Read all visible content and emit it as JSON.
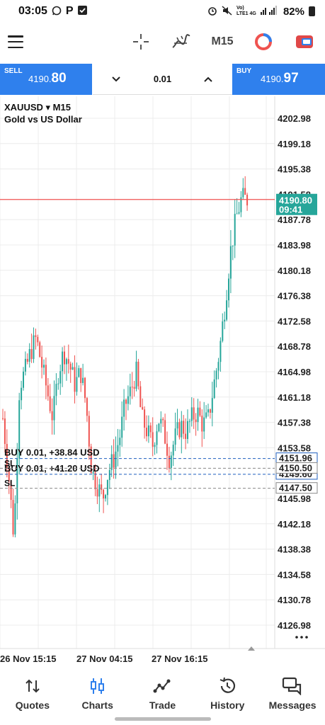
{
  "status_bar": {
    "time": "03:05",
    "left_icons": [
      "whatsapp-icon",
      "p-icon",
      "check-box-icon"
    ],
    "network": "Vo) LTE1 4G",
    "battery": "82%"
  },
  "toolbar": {
    "timeframe": "M15",
    "icons": [
      "menu-icon",
      "crosshair-icon",
      "indicators-icon",
      "timeframe",
      "oneclick-icon",
      "trade-icon"
    ]
  },
  "trade": {
    "sell_label": "SELL",
    "sell_price_main": "4190.",
    "sell_price_big": "80",
    "buy_label": "BUY",
    "buy_price_main": "4190.",
    "buy_price_big": "97",
    "lot": "0.01"
  },
  "chart": {
    "symbol": "XAUUSD ▾ M15",
    "description": "Gold vs US Dollar",
    "bid_label": "4190.80",
    "timer_label": "09:41",
    "hidden_top_label": "4191.58",
    "price_axis": [
      "4202.98",
      "4199.18",
      "4195.38",
      "4187.78",
      "4183.98",
      "4180.18",
      "4176.38",
      "4172.58",
      "4168.78",
      "4164.98",
      "4161.18",
      "4157.38",
      "4153.58",
      "4145.98",
      "4142.18",
      "4138.38",
      "4134.58",
      "4130.78",
      "4126.98"
    ],
    "time_axis": [
      "26 Nov 15:15",
      "27 Nov 04:15",
      "27 Nov 16:15"
    ],
    "positions": [
      {
        "label": "BUY 0.01,",
        "profit": "+38.84 USD",
        "price": "4151.96"
      },
      {
        "label": "BUY 0.01,",
        "profit": "+41.20 USD",
        "price": "4149.60"
      }
    ],
    "sl_label": "SL",
    "sl_prices": [
      "4150.50",
      "4147.50"
    ],
    "colors": {
      "bull": "#26a69a",
      "bear": "#ef5350",
      "bid_line": "#ef5350",
      "order_line": "#1f5fbf",
      "sl_line": "#888888",
      "bid_box": "#26a69a"
    }
  },
  "chart_data": {
    "type": "candlestick",
    "symbol": "XAUUSD",
    "timeframe": "M15",
    "ylim": [
      4124.0,
      4206.0
    ],
    "close_series_approx": [
      4158,
      4150,
      4140,
      4163,
      4165,
      4168,
      4170,
      4166,
      4162,
      4158,
      4165,
      4168,
      4166,
      4163,
      4165,
      4160,
      4150,
      4148,
      4146,
      4150,
      4152,
      4155,
      4160,
      4162,
      4165,
      4158,
      4156,
      4154,
      4158,
      4156,
      4152,
      4155,
      4157,
      4156,
      4158,
      4159,
      4157,
      4158,
      4163,
      4168,
      4175,
      4183,
      4188,
      4191,
      4190.8
    ]
  },
  "nav": {
    "items": [
      {
        "label": "Quotes",
        "icon": "quotes-icon"
      },
      {
        "label": "Charts",
        "icon": "charts-icon"
      },
      {
        "label": "Trade",
        "icon": "trade-icon"
      },
      {
        "label": "History",
        "icon": "history-icon"
      },
      {
        "label": "Messages",
        "icon": "messages-icon"
      }
    ]
  }
}
